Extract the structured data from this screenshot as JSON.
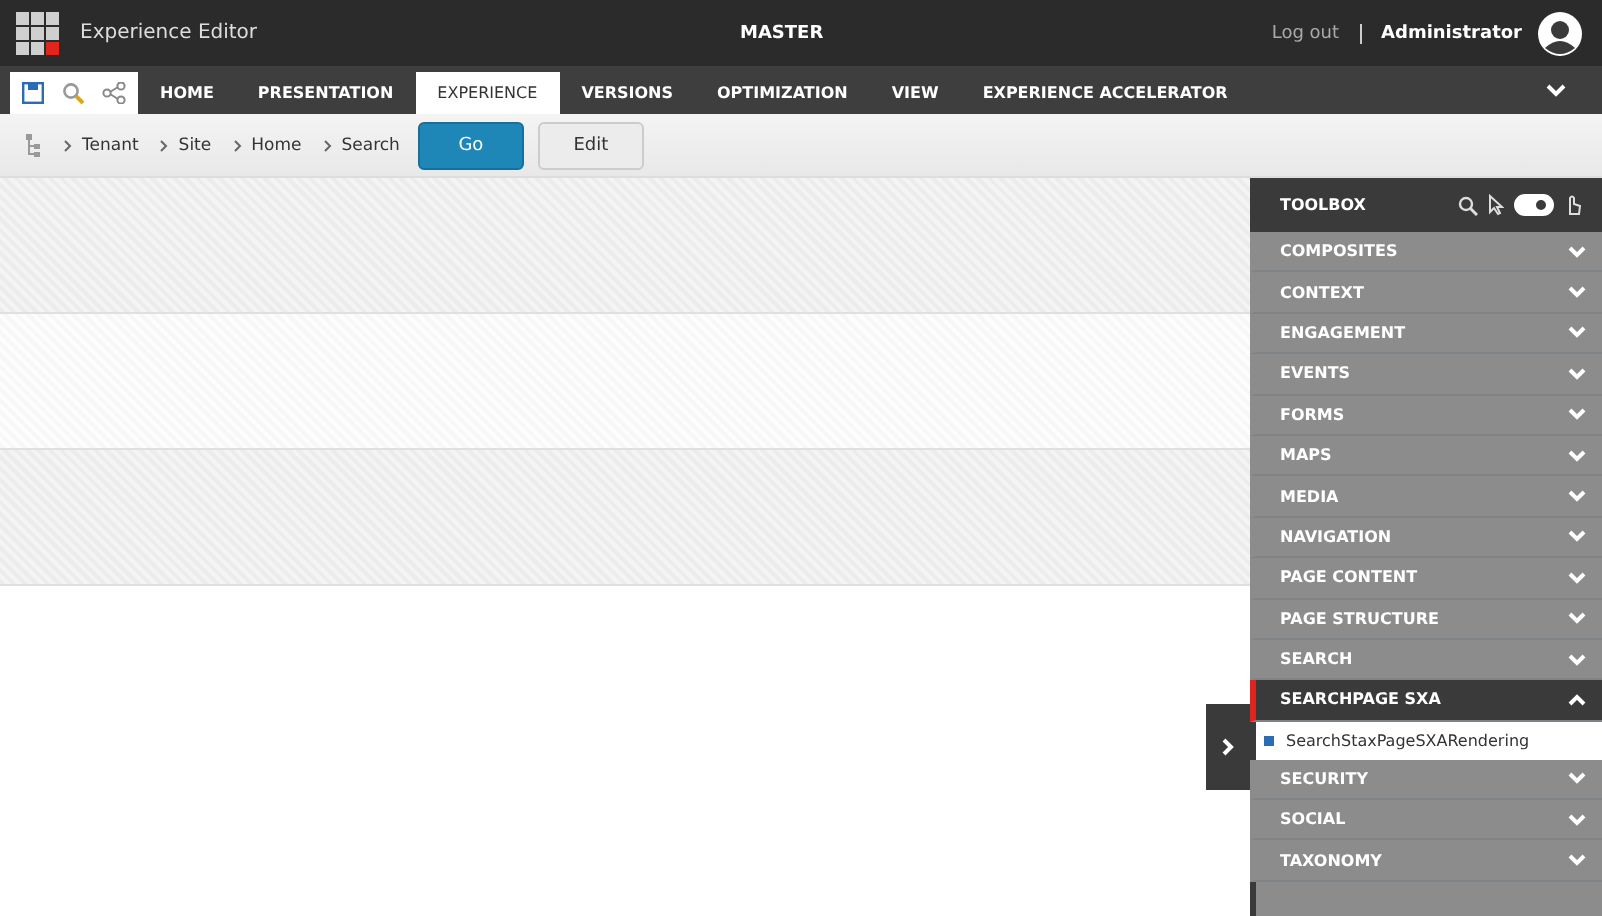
{
  "app_title": "Experience Editor",
  "database": "MASTER",
  "logout": "Log out",
  "user": "Administrator",
  "ribbon_tabs": [
    {
      "label": "HOME",
      "selected": false
    },
    {
      "label": "PRESENTATION",
      "selected": false
    },
    {
      "label": "EXPERIENCE",
      "selected": true
    },
    {
      "label": "VERSIONS",
      "selected": false
    },
    {
      "label": "OPTIMIZATION",
      "selected": false
    },
    {
      "label": "VIEW",
      "selected": false
    },
    {
      "label": "EXPERIENCE ACCELERATOR",
      "selected": false
    }
  ],
  "breadcrumb": [
    "Tenant",
    "Site",
    "Home",
    "Search"
  ],
  "buttons": [
    {
      "label": "Go",
      "kind": "primary"
    },
    {
      "label": "Edit",
      "kind": "secondary"
    }
  ],
  "toolbox": {
    "title": "TOOLBOX",
    "toggle_on": true,
    "sections": [
      {
        "label": "COMPOSITES",
        "expanded": false
      },
      {
        "label": "CONTEXT",
        "expanded": false
      },
      {
        "label": "ENGAGEMENT",
        "expanded": false
      },
      {
        "label": "EVENTS",
        "expanded": false
      },
      {
        "label": "FORMS",
        "expanded": false
      },
      {
        "label": "MAPS",
        "expanded": false
      },
      {
        "label": "MEDIA",
        "expanded": false
      },
      {
        "label": "NAVIGATION",
        "expanded": false
      },
      {
        "label": "PAGE CONTENT",
        "expanded": false
      },
      {
        "label": "PAGE STRUCTURE",
        "expanded": false
      },
      {
        "label": "SEARCH",
        "expanded": false
      },
      {
        "label": "SEARCHPAGE SXA",
        "expanded": true,
        "children": [
          "SearchStaxPageSXARendering"
        ]
      },
      {
        "label": "SECURITY",
        "expanded": false
      },
      {
        "label": "SOCIAL",
        "expanded": false
      },
      {
        "label": "TAXONOMY",
        "expanded": false
      }
    ]
  }
}
